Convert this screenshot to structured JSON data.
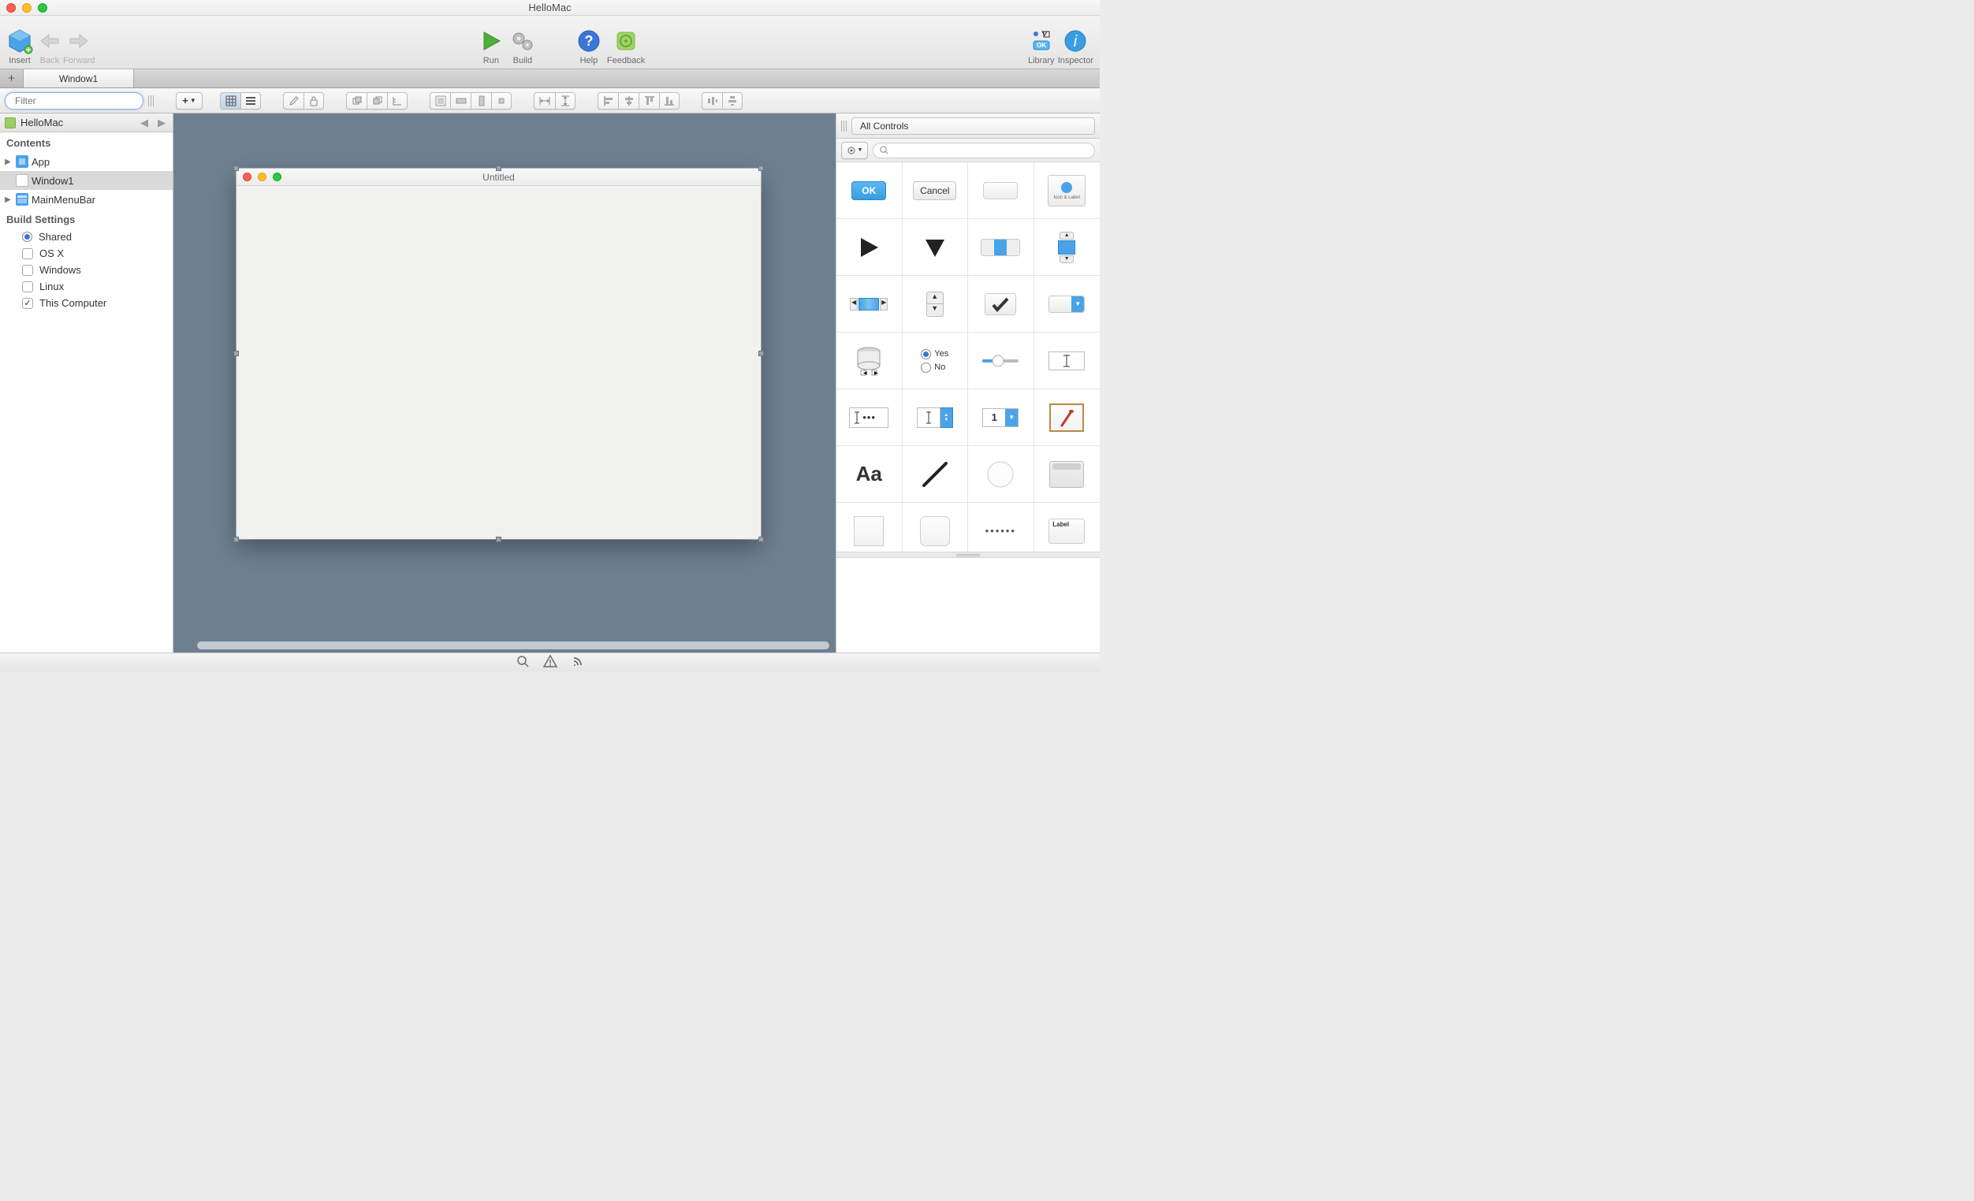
{
  "window": {
    "title": "HelloMac"
  },
  "toolbar": {
    "insert": "Insert",
    "back": "Back",
    "forward": "Forward",
    "run": "Run",
    "build": "Build",
    "help": "Help",
    "feedback": "Feedback",
    "library": "Library",
    "inspector": "Inspector"
  },
  "tabs": {
    "0": {
      "label": "Window1"
    }
  },
  "navigator": {
    "filter_placeholder": "Filter",
    "project": "HelloMac",
    "sections": {
      "contents": "Contents",
      "build_settings": "Build Settings"
    },
    "items": {
      "app": "App",
      "window1": "Window1",
      "mainmenubar": "MainMenuBar"
    },
    "build": {
      "shared": "Shared",
      "osx": "OS X",
      "windows": "Windows",
      "linux": "Linux",
      "this_computer": "This Computer"
    }
  },
  "designer": {
    "window_title": "Untitled"
  },
  "library": {
    "filter_label": "All Controls",
    "search_placeholder": "",
    "controls": {
      "ok": "OK",
      "cancel": "Cancel",
      "icon_label": "Icon & Label",
      "yes": "Yes",
      "no": "No",
      "one": "1",
      "aa": "Aa",
      "label": "Label",
      "dots": "••••••"
    }
  }
}
